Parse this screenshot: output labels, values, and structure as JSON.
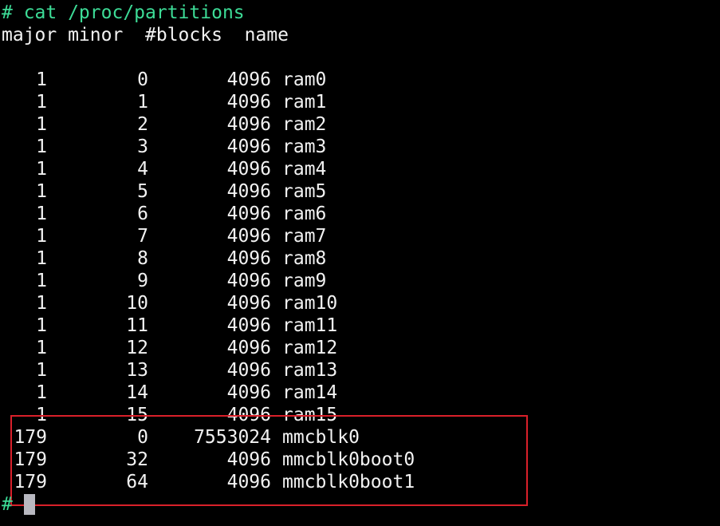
{
  "terminal": {
    "command_line": "# cat /proc/partitions",
    "header": "major minor  #blocks  name",
    "rows": [
      {
        "major": "1",
        "minor": "0",
        "blocks": "4096",
        "name": "ram0"
      },
      {
        "major": "1",
        "minor": "1",
        "blocks": "4096",
        "name": "ram1"
      },
      {
        "major": "1",
        "minor": "2",
        "blocks": "4096",
        "name": "ram2"
      },
      {
        "major": "1",
        "minor": "3",
        "blocks": "4096",
        "name": "ram3"
      },
      {
        "major": "1",
        "minor": "4",
        "blocks": "4096",
        "name": "ram4"
      },
      {
        "major": "1",
        "minor": "5",
        "blocks": "4096",
        "name": "ram5"
      },
      {
        "major": "1",
        "minor": "6",
        "blocks": "4096",
        "name": "ram6"
      },
      {
        "major": "1",
        "minor": "7",
        "blocks": "4096",
        "name": "ram7"
      },
      {
        "major": "1",
        "minor": "8",
        "blocks": "4096",
        "name": "ram8"
      },
      {
        "major": "1",
        "minor": "9",
        "blocks": "4096",
        "name": "ram9"
      },
      {
        "major": "1",
        "minor": "10",
        "blocks": "4096",
        "name": "ram10"
      },
      {
        "major": "1",
        "minor": "11",
        "blocks": "4096",
        "name": "ram11"
      },
      {
        "major": "1",
        "minor": "12",
        "blocks": "4096",
        "name": "ram12"
      },
      {
        "major": "1",
        "minor": "13",
        "blocks": "4096",
        "name": "ram13"
      },
      {
        "major": "1",
        "minor": "14",
        "blocks": "4096",
        "name": "ram14"
      },
      {
        "major": "1",
        "minor": "15",
        "blocks": "4096",
        "name": "ram15"
      },
      {
        "major": "179",
        "minor": "0",
        "blocks": "7553024",
        "name": "mmcblk0"
      },
      {
        "major": "179",
        "minor": "32",
        "blocks": "4096",
        "name": "mmcblk0boot0"
      },
      {
        "major": "179",
        "minor": "64",
        "blocks": "4096",
        "name": "mmcblk0boot1"
      }
    ],
    "prompt": "#"
  },
  "colors": {
    "background": "#000000",
    "text": "#f2f2f2",
    "command": "#3ddc97",
    "highlight_border": "#d9202a",
    "cursor": "#b8b8c0"
  }
}
